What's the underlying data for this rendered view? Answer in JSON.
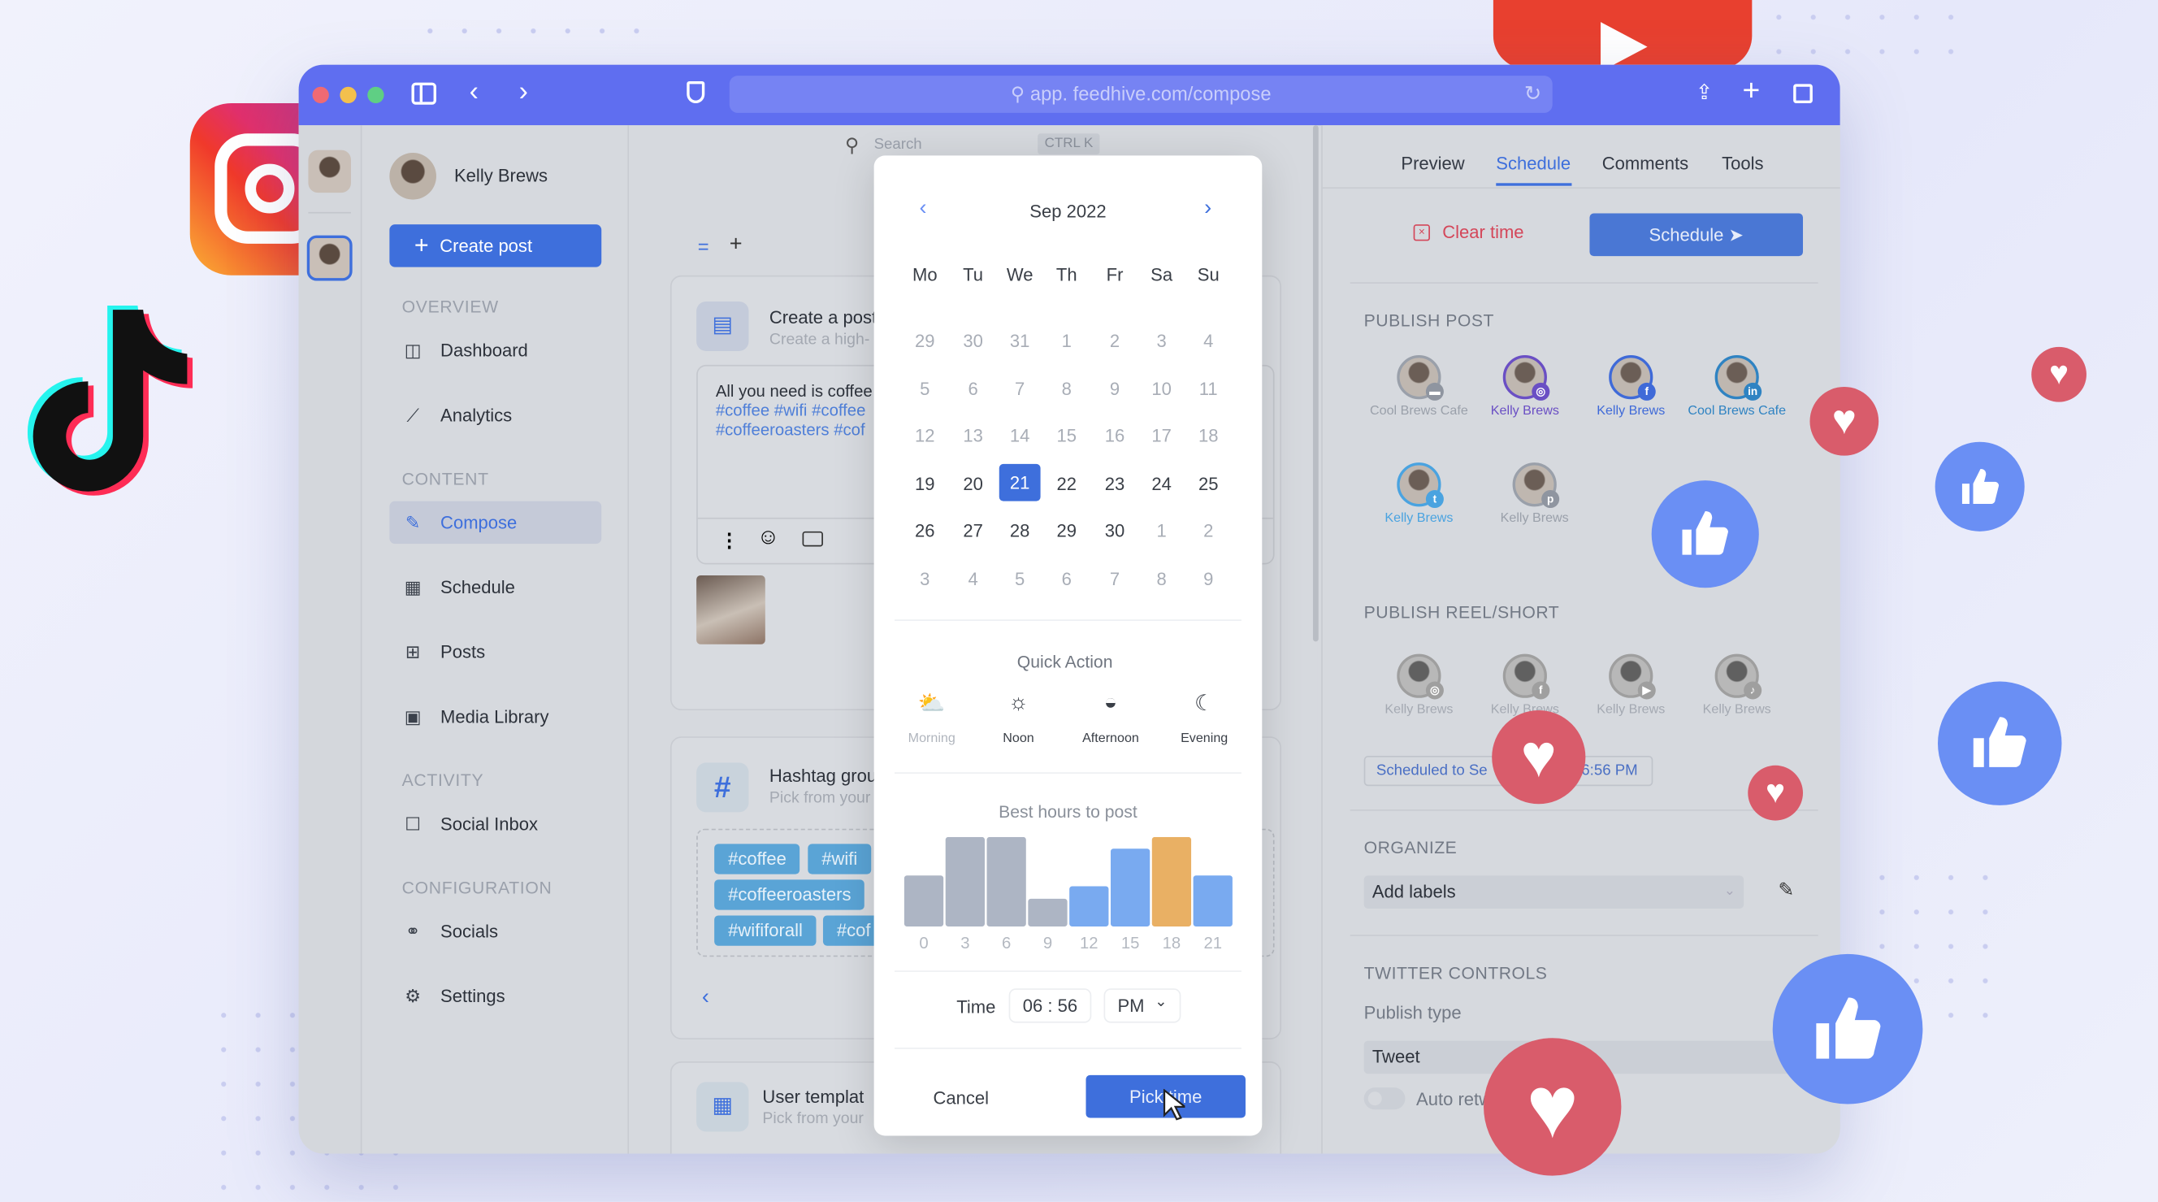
{
  "browser": {
    "url": "app. feedhive.com/compose"
  },
  "sidebar": {
    "user_name": "Kelly Brews",
    "create_post": "Create post",
    "sections": [
      {
        "title": "OVERVIEW",
        "items": [
          {
            "label": "Dashboard",
            "icon": "dashboard-icon"
          },
          {
            "label": "Analytics",
            "icon": "analytics-icon"
          }
        ]
      },
      {
        "title": "CONTENT",
        "items": [
          {
            "label": "Compose",
            "icon": "compose-icon",
            "active": true
          },
          {
            "label": "Schedule",
            "icon": "calendar-icon"
          },
          {
            "label": "Posts",
            "icon": "grid-icon"
          },
          {
            "label": "Media Library",
            "icon": "media-icon"
          }
        ]
      },
      {
        "title": "ACTIVITY",
        "items": [
          {
            "label": "Social Inbox",
            "icon": "inbox-icon"
          }
        ]
      },
      {
        "title": "CONFIGURATION",
        "items": [
          {
            "label": "Socials",
            "icon": "socials-icon"
          },
          {
            "label": "Settings",
            "icon": "gear-icon"
          }
        ]
      }
    ]
  },
  "compose": {
    "search_partial": "Search",
    "shortcut": "CTRL K",
    "post_card": {
      "title": "Create a post",
      "subtitle": "Create a high-",
      "text": "All you need is coffee",
      "hashtags1": "#coffee #wifi #coffee",
      "hashtags2": "#coffeeroasters #cof"
    },
    "hashtag_card": {
      "title": "Hashtag group",
      "subtitle": "Pick from your",
      "tags": [
        "#coffee",
        "#wifi",
        "#coffeeroasters",
        "#wififorall",
        "#cof"
      ]
    },
    "template_card": {
      "title": "User templat",
      "subtitle": "Pick from your"
    }
  },
  "picker": {
    "month": "Sep 2022",
    "weekdays": [
      "Mo",
      "Tu",
      "We",
      "Th",
      "Fr",
      "Sa",
      "Su"
    ],
    "weeks": [
      [
        "29",
        "30",
        "31",
        "1",
        "2",
        "3",
        "4"
      ],
      [
        "5",
        "6",
        "7",
        "8",
        "9",
        "10",
        "11"
      ],
      [
        "12",
        "13",
        "14",
        "15",
        "16",
        "17",
        "18"
      ],
      [
        "19",
        "20",
        "21",
        "22",
        "23",
        "24",
        "25"
      ],
      [
        "26",
        "27",
        "28",
        "29",
        "30",
        "1",
        "2"
      ],
      [
        "3",
        "4",
        "5",
        "6",
        "7",
        "8",
        "9"
      ]
    ],
    "selected": "21",
    "quick_action_title": "Quick Action",
    "quick_actions": [
      {
        "label": "Morning",
        "icon": "sunrise-icon"
      },
      {
        "label": "Noon",
        "icon": "sun-icon"
      },
      {
        "label": "Afternoon",
        "icon": "sunset-icon"
      },
      {
        "label": "Evening",
        "icon": "moon-icon"
      }
    ],
    "time_label": "Time",
    "hour": "06",
    "minute": "56",
    "ampm": "PM",
    "cancel": "Cancel",
    "pick": "Pick time"
  },
  "chart_data": {
    "type": "bar",
    "title": "Best hours to post",
    "categories": [
      "0",
      "3",
      "6",
      "9",
      "12",
      "15",
      "18",
      "21"
    ],
    "values": [
      57,
      100,
      100,
      31,
      45,
      87,
      100,
      57
    ],
    "colors": [
      "#adb5c4",
      "#adb5c4",
      "#adb5c4",
      "#adb5c4",
      "#79aaf0",
      "#79aaf0",
      "#e9b064",
      "#79aaf0"
    ],
    "ylim": [
      0,
      100
    ]
  },
  "panel": {
    "tabs": [
      "Preview",
      "Schedule",
      "Comments",
      "Tools"
    ],
    "active_tab": "Schedule",
    "clear_time": "Clear time",
    "schedule": "Schedule",
    "publish_post": "PUBLISH POST",
    "post_accounts": [
      {
        "name": "Cool Brews Cafe",
        "network": "gmb",
        "color": "#9aa0aa",
        "badge": "#8f95a0"
      },
      {
        "name": "Kelly Brews",
        "network": "instagram",
        "color": "#6a4fc4",
        "badge": "#6a4fc4"
      },
      {
        "name": "Kelly Brews",
        "network": "facebook",
        "color": "#3f6ad8",
        "badge": "#3f6ad8"
      },
      {
        "name": "Cool Brews Cafe",
        "network": "linkedin",
        "color": "#2f83c2",
        "badge": "#2f83c2"
      },
      {
        "name": "Kelly Brews",
        "network": "twitter",
        "color": "#4aa3e0",
        "badge": "#4aa3e0"
      },
      {
        "name": "Kelly Brews",
        "network": "pinterest",
        "color": "#9aa0aa",
        "badge": "#8f95a0"
      }
    ],
    "publish_reel": "PUBLISH REEL/SHORT",
    "reel_accounts": [
      {
        "name": "Kelly Brews",
        "network": "instagram"
      },
      {
        "name": "Kelly Brews",
        "network": "facebook"
      },
      {
        "name": "Kelly Brews",
        "network": "youtube"
      },
      {
        "name": "Kelly Brews",
        "network": "tiktok"
      }
    ],
    "scheduled_a": "Scheduled to Se",
    "scheduled_b": "6:56 PM",
    "organize": "ORGANIZE",
    "labels_placeholder": "Add labels",
    "twitter_controls": "TWITTER CONTROLS",
    "publish_type_label": "Publish type",
    "publish_type": "Tweet",
    "auto_retweet": "Auto retw"
  },
  "colors": {
    "accent": "#3e6fdc",
    "titlebar": "#5f6ef0",
    "danger": "#d4475a",
    "heart": "#d95c6b",
    "thumb": "#6a8ff4"
  }
}
